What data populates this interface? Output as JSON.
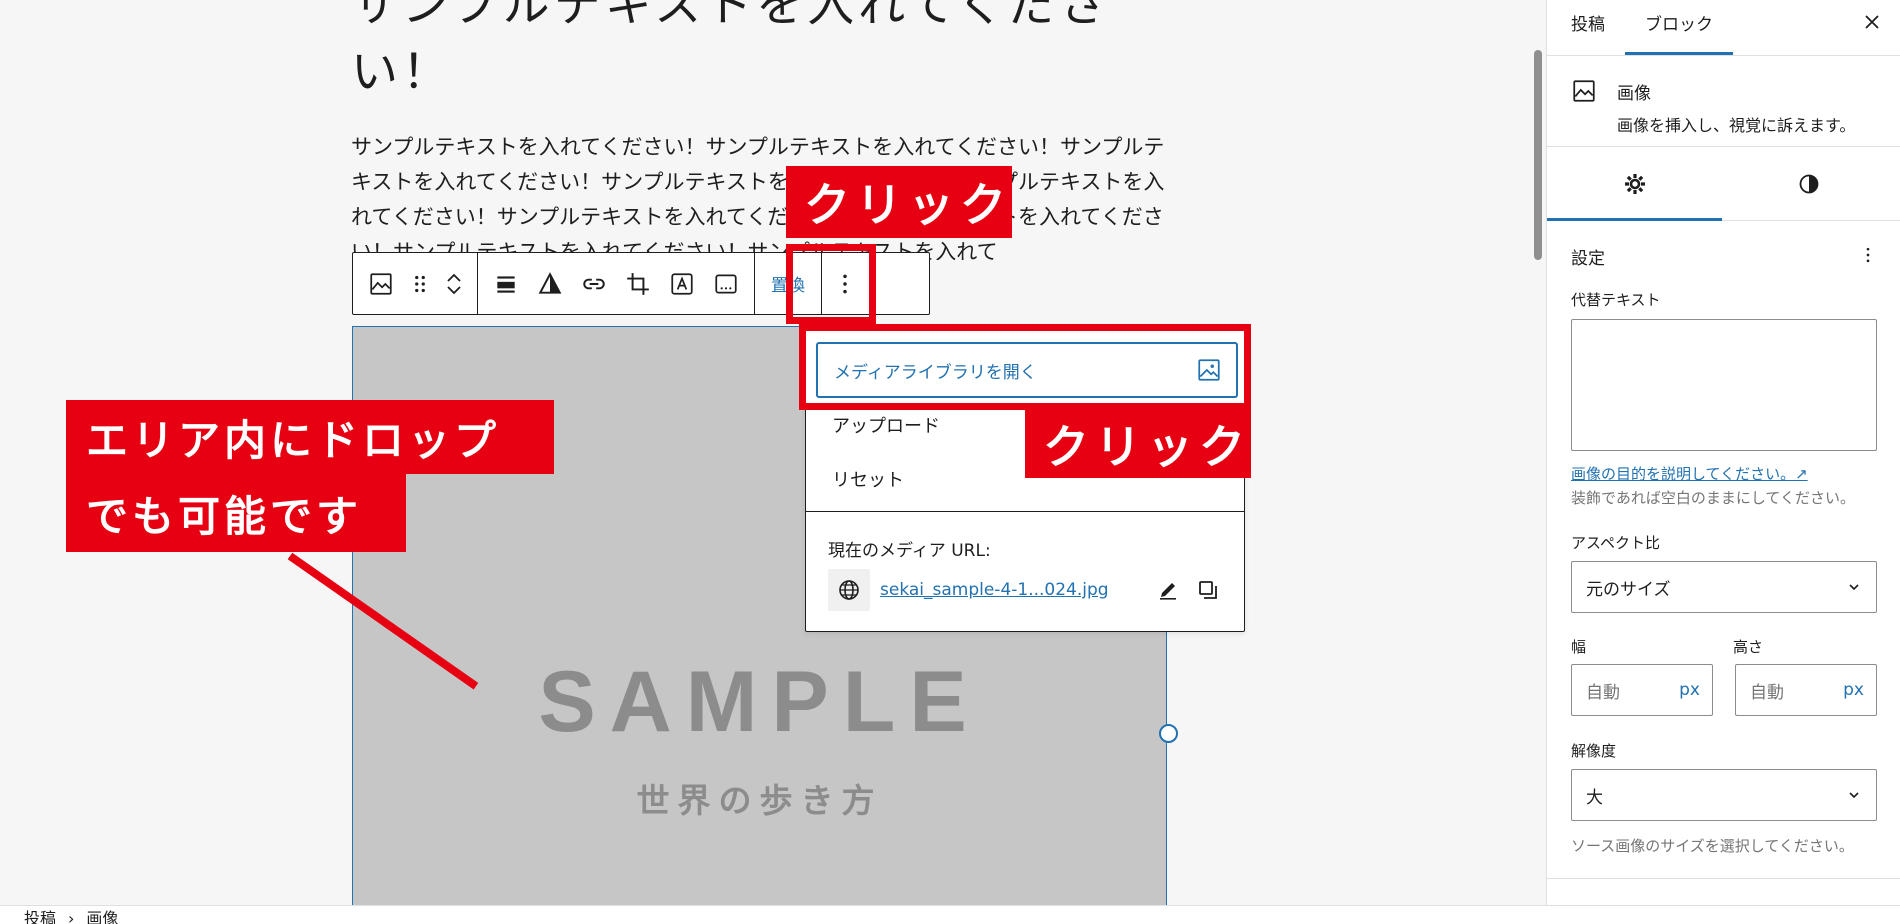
{
  "post": {
    "title_line1": "サンプルテキストを入れてくださ",
    "title_line2": "い！",
    "paragraph": "サンプルテキストを入れてください！サンプルテキストを入れてください！サンプルテキストを入れてください！サンプルテキストを入れてください！サンプルテキストを入れてください！サンプルテキストを入れてください！サンプルテキストを入れてください！サンプルテキストを入れてください！サンプルテキストを入れて"
  },
  "toolbar": {
    "replace_label": "置換"
  },
  "image": {
    "sample_text": "SAMPLE",
    "sample_subtext": "世界の歩き方"
  },
  "replace_menu": {
    "open_media_library": "メディアライブラリを開く",
    "upload": "アップロード",
    "reset": "リセット",
    "current_url_label": "現在のメディア URL:",
    "current_file": "sekai_sample-4-1...024.jpg"
  },
  "annotations": {
    "click_top": "クリック",
    "click_menu": "クリック",
    "drop_line1": "エリア内にドロップ",
    "drop_line2": "でも可能です",
    "color": "#e60012"
  },
  "breadcrumb": {
    "items": [
      "投稿",
      "画像"
    ],
    "separator": "›"
  },
  "sidebar": {
    "tabs": {
      "post": "投稿",
      "block": "ブロック"
    },
    "block_card": {
      "name": "画像",
      "description": "画像を挿入し、視覚に訴えます。"
    },
    "settings": {
      "section_title": "設定",
      "alt_label": "代替テキスト",
      "alt_help_link": "画像の目的を説明してください。↗",
      "alt_help_text": "装飾であれば空白のままにしてください。",
      "aspect_label": "アスペクト比",
      "aspect_value": "元のサイズ",
      "width_label": "幅",
      "height_label": "高さ",
      "width_placeholder": "自動",
      "height_placeholder": "自動",
      "unit": "px",
      "resolution_label": "解像度",
      "resolution_value": "大",
      "resolution_help": "ソース画像のサイズを選択してください。"
    }
  },
  "colors": {
    "accent": "#2271b1",
    "annotation_red": "#e60012",
    "placeholder_gray": "#c6c6c6"
  }
}
